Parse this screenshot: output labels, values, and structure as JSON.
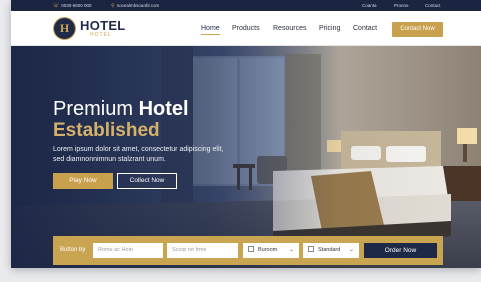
{
  "topbar": {
    "phone": "0030-6600 000",
    "email": "nocealmbsoanbl.com",
    "links": [
      "Coanta",
      "Pronne",
      "Contact"
    ]
  },
  "logo": {
    "mark": "H",
    "name": "HOTEL",
    "sub": "HOTEL"
  },
  "nav": {
    "items": [
      "Home",
      "Products",
      "Resources",
      "Pricing",
      "Contact"
    ],
    "active": "Home",
    "cta": "Contact Now"
  },
  "hero": {
    "title_light": "Premium ",
    "title_bold": "Hotel",
    "title_line2": "Established",
    "body": "Lorem ipsum dolor sit amet, consectetur adipiscing elit, sed diamnonnimnun stalzrant unum.",
    "primary_button": "Play Now",
    "secondary_button": "Collect Now"
  },
  "booking": {
    "label": "Button by",
    "field1_placeholder": "Rome ac Hoin",
    "field2_placeholder": "Scorp ne frme",
    "room_type": "Buroom",
    "room_class": "Standard",
    "order_button": "Order Now"
  },
  "colors": {
    "navy": "#1f2a48",
    "gold": "#c8a04e"
  }
}
